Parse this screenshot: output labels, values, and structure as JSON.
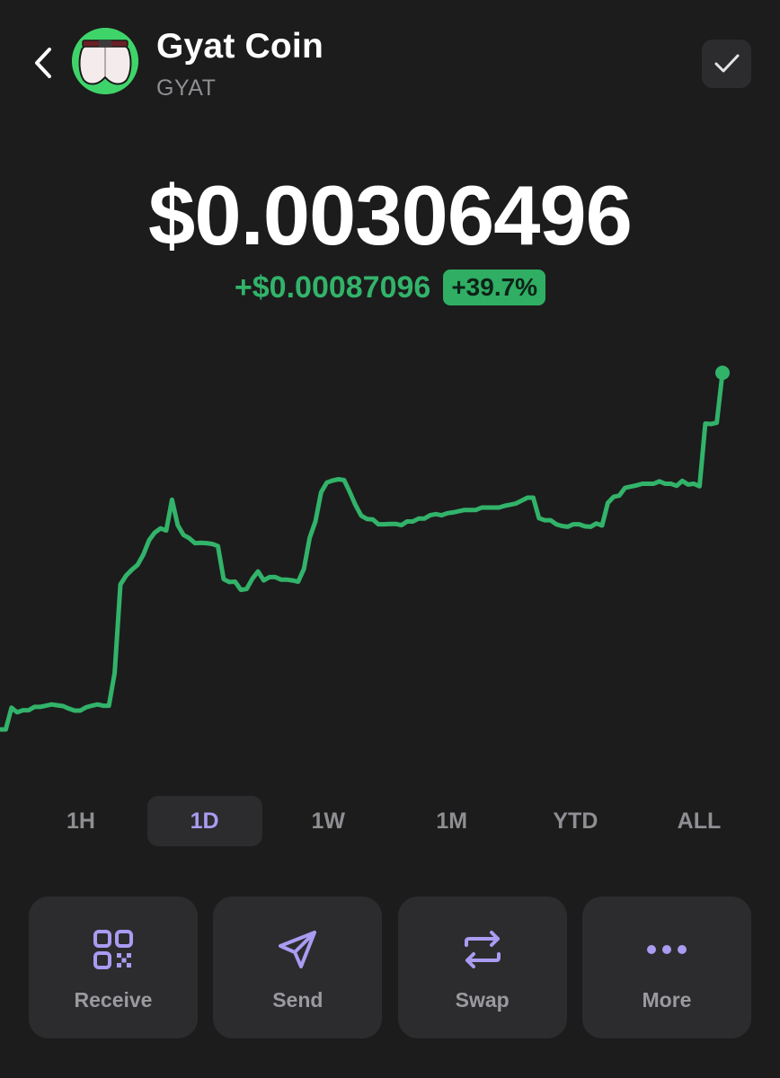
{
  "coin": {
    "name": "Gyat Coin",
    "ticker": "GYAT",
    "price": "$0.00306496",
    "change_amount": "+$0.00087096",
    "change_percent": "+39.7%"
  },
  "icons": {
    "back": "chevron-left-icon",
    "done": "checkmark-icon",
    "receive": "qr-code-icon",
    "send": "paper-plane-icon",
    "swap": "swap-arrows-icon",
    "more": "ellipsis-icon"
  },
  "colors": {
    "background": "#1c1c1c",
    "surface": "#2c2c2e",
    "positive": "#32b36a",
    "accent": "#a99cf2",
    "muted": "#8e8e93"
  },
  "time_ranges": [
    {
      "label": "1H",
      "active": false
    },
    {
      "label": "1D",
      "active": true
    },
    {
      "label": "1W",
      "active": false
    },
    {
      "label": "1M",
      "active": false
    },
    {
      "label": "YTD",
      "active": false
    },
    {
      "label": "ALL",
      "active": false
    }
  ],
  "actions": {
    "receive": "Receive",
    "send": "Send",
    "swap": "Swap",
    "more": "More"
  },
  "chart_data": {
    "type": "line",
    "title": "",
    "series": [
      {
        "color": "#32b36a",
        "values": [
          0.002194,
          0.002194,
          0.002247,
          0.002236,
          0.002241,
          0.002241,
          0.002249,
          0.002249,
          0.002252,
          0.002255,
          0.002253,
          0.002251,
          0.002245,
          0.00224,
          0.00224,
          0.002248,
          0.002252,
          0.002255,
          0.002252,
          0.002252,
          0.002332,
          0.002548,
          0.00257,
          0.002584,
          0.002596,
          0.002621,
          0.002656,
          0.002675,
          0.002685,
          0.00268,
          0.002755,
          0.002693,
          0.002669,
          0.002661,
          0.002649,
          0.00265,
          0.002649,
          0.002647,
          0.002642,
          0.002561,
          0.002554,
          0.002555,
          0.002535,
          0.002537,
          0.002562,
          0.00258,
          0.002558,
          0.002566,
          0.002566,
          0.00256,
          0.00256,
          0.002558,
          0.002555,
          0.002586,
          0.002662,
          0.002702,
          0.002773,
          0.002797,
          0.002802,
          0.002805,
          0.002803,
          0.002774,
          0.002742,
          0.002716,
          0.002708,
          0.002707,
          0.002695,
          0.002695,
          0.002696,
          0.002696,
          0.002693,
          0.002702,
          0.002702,
          0.002709,
          0.002709,
          0.002717,
          0.00272,
          0.002717,
          0.002722,
          0.002724,
          0.002727,
          0.00273,
          0.00273,
          0.00273,
          0.002736,
          0.002736,
          0.002736,
          0.002736,
          0.00274,
          0.002743,
          0.002746,
          0.002753,
          0.00276,
          0.00276,
          0.00271,
          0.002705,
          0.002705,
          0.002695,
          0.002691,
          0.002689,
          0.002695,
          0.002695,
          0.00269,
          0.002689,
          0.002697,
          0.002692,
          0.002747,
          0.002762,
          0.002765,
          0.002784,
          0.002787,
          0.00279,
          0.002794,
          0.002794,
          0.002794,
          0.0028,
          0.002794,
          0.002794,
          0.002789,
          0.002801,
          0.002792,
          0.002794,
          0.002788,
          0.002941,
          0.00294,
          0.002943,
          0.003065
        ]
      }
    ],
    "x_range": "1D",
    "grid": false,
    "legend": false
  }
}
